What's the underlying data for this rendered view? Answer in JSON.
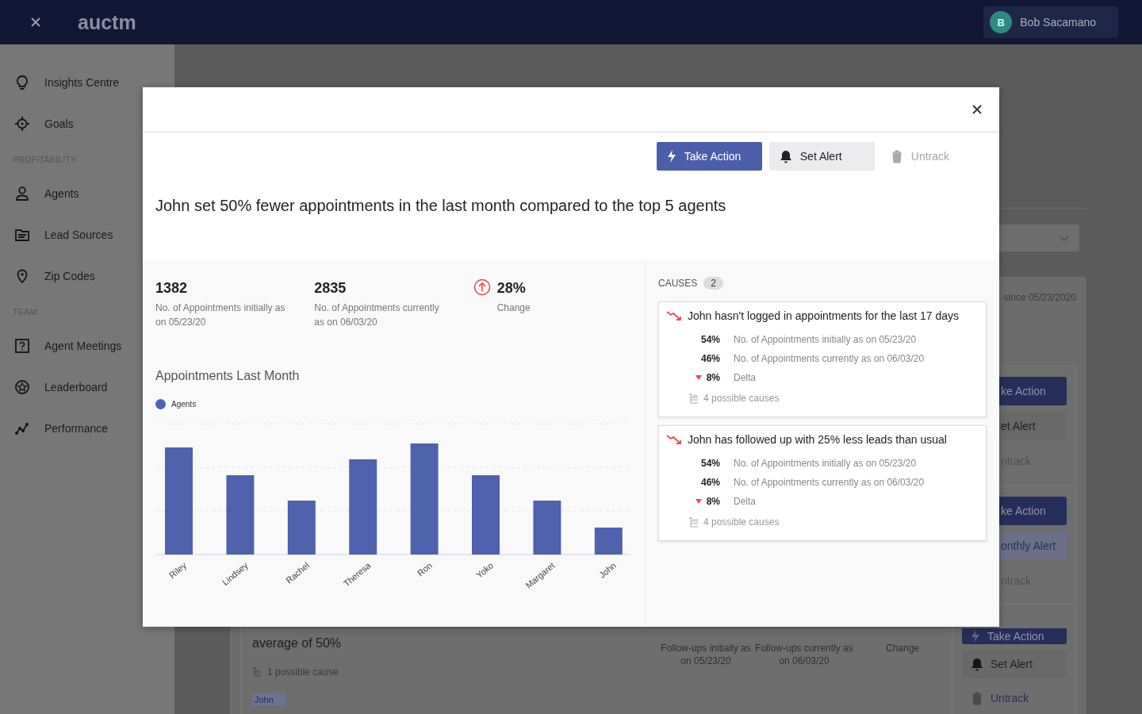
{
  "header": {
    "app_name": "auctm",
    "user": {
      "initial": "B",
      "name": "Bob Sacamano"
    }
  },
  "sidebar": {
    "sections": [
      {
        "items": [
          {
            "label": "Insights Centre"
          },
          {
            "label": "Goals"
          }
        ]
      },
      {
        "heading": "PROFITABILITY",
        "items": [
          {
            "label": "Agents"
          },
          {
            "label": "Lead Sources"
          },
          {
            "label": "Zip Codes"
          }
        ]
      },
      {
        "heading": "TEAM",
        "items": [
          {
            "label": "Agent Meetings"
          },
          {
            "label": "Leaderboard"
          },
          {
            "label": "Performance"
          }
        ]
      }
    ]
  },
  "background": {
    "date_note": "since 05/23/2020",
    "insights": [
      {
        "actions": [
          {
            "kind": "primary",
            "label": "ke Action"
          },
          {
            "kind": "secondary",
            "label": "et Alert"
          },
          {
            "kind": "link",
            "label": "ntrack"
          }
        ]
      },
      {
        "actions": [
          {
            "kind": "primary",
            "label": "ke Action"
          },
          {
            "kind": "alert",
            "label": "onthly Alert"
          },
          {
            "kind": "link",
            "label": "ntrack"
          }
        ]
      },
      {
        "text": "average of 50%",
        "cause_note": "1 possible cause",
        "tag": "John",
        "stats": [
          {
            "label": "Follow-ups initially as on 05/23/20"
          },
          {
            "label": "Follow-ups currently as on 06/03/20"
          },
          {
            "label": "Change"
          }
        ],
        "actions": [
          {
            "kind": "primary",
            "label": "Take Action"
          },
          {
            "kind": "secondary",
            "label": "Set Alert"
          },
          {
            "kind": "untrack",
            "label": "Untrack"
          }
        ]
      }
    ]
  },
  "modal": {
    "actions": [
      {
        "kind": "primary",
        "label": "Take Action",
        "disabled": false
      },
      {
        "kind": "secondary",
        "label": "Set Alert",
        "disabled": false
      },
      {
        "kind": "untrack",
        "label": "Untrack",
        "disabled": true
      }
    ],
    "headline": "John set 50% fewer appointments in the last month compared to the top 5 agents",
    "stats": [
      {
        "value": "1382",
        "label": "No. of Appointments initially as on 05/23/20"
      },
      {
        "value": "2835",
        "label": "No. of Appointments currently as on 06/03/20"
      },
      {
        "value": "28%",
        "label": "Change",
        "kind": "change_up"
      }
    ],
    "chart": {
      "title": "Appointments Last Month",
      "legend": "Agents",
      "categories": [
        "Riley",
        "Lindsey",
        "Rachel",
        "Theresa",
        "Ron",
        "Yoko",
        "Margaret",
        "John"
      ]
    },
    "causes": {
      "heading": "CAUSES",
      "count": "2",
      "items": [
        {
          "title": "John hasn't logged in appointments for the last 17 days",
          "metrics": [
            {
              "value": "54%",
              "label": "No. of Appointments initially as on 05/23/20"
            },
            {
              "value": "46%",
              "label": "No. of Appointments currently as on 06/03/20"
            },
            {
              "value": "8%",
              "label": "Delta",
              "kind": "delta_down"
            }
          ],
          "note": "4 possible causes"
        },
        {
          "title": "John has followed up with 25% less leads than usual",
          "metrics": [
            {
              "value": "54%",
              "label": "No. of Appointments initially as on 05/23/20"
            },
            {
              "value": "46%",
              "label": "No. of Appointments currently as on 06/03/20"
            },
            {
              "value": "8%",
              "label": "Delta",
              "kind": "delta_down"
            }
          ],
          "note": "4 possible causes"
        }
      ]
    }
  }
}
